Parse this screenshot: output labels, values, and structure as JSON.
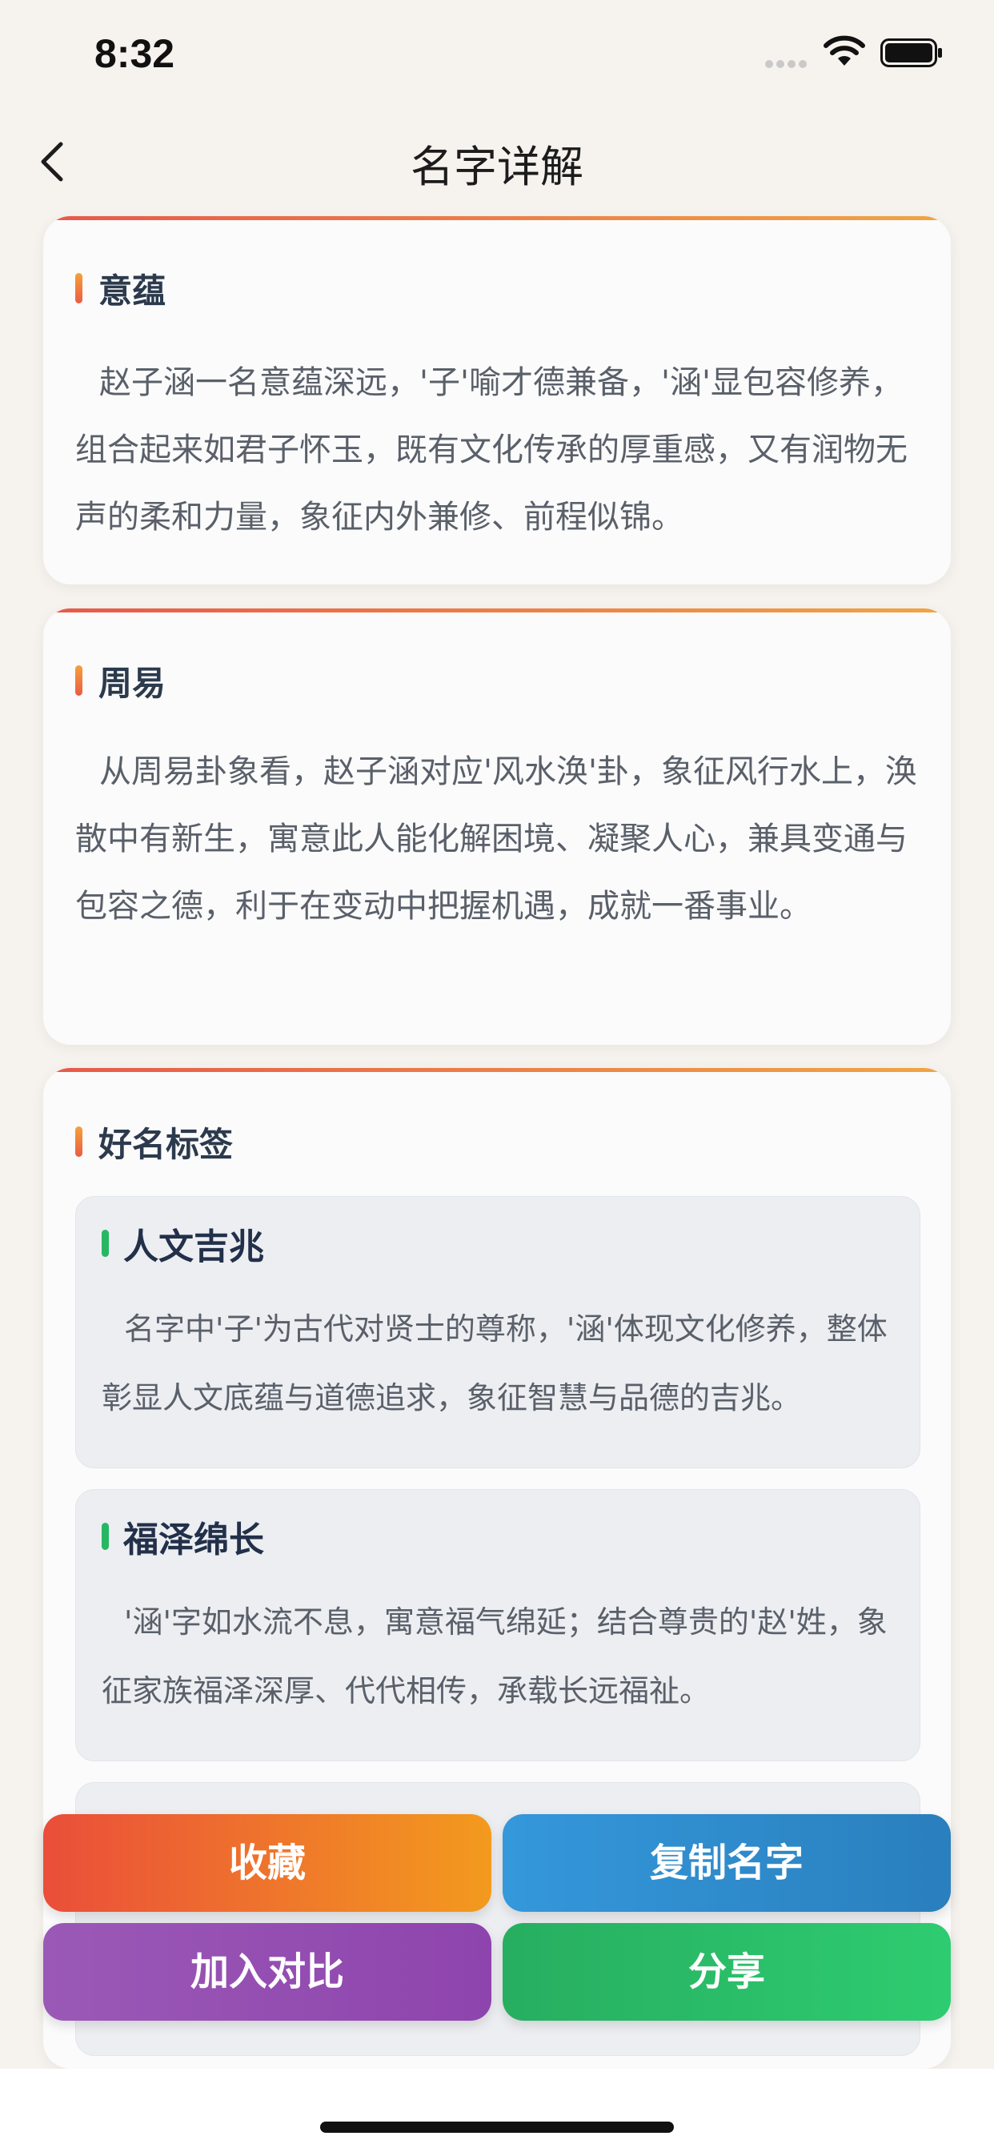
{
  "status": {
    "time": "8:32"
  },
  "nav": {
    "title": "名字详解"
  },
  "cards": {
    "meaning": {
      "title": "意蕴",
      "text": "赵子涵一名意蕴深远，'子'喻才德兼备，'涵'显包容修养，组合起来如君子怀玉，既有文化传承的厚重感，又有润物无声的柔和力量，象征内外兼修、前程似锦。"
    },
    "zhouyi": {
      "title": "周易",
      "text": "从周易卦象看，赵子涵对应'风水涣'卦，象征风行水上，涣散中有新生，寓意此人能化解困境、凝聚人心，兼具变通与包容之德，利于在变动中把握机遇，成就一番事业。"
    },
    "tags": {
      "title": "好名标签",
      "items": [
        {
          "title": "人文吉兆",
          "text": "名字中'子'为古代对贤士的尊称，'涵'体现文化修养，整体彰显人文底蕴与道德追求，象征智慧与品德的吉兆。"
        },
        {
          "title": "福泽绵长",
          "text": "'涵'字如水流不息，寓意福气绵延；结合尊贵的'赵'姓，象征家族福泽深厚、代代相传，承载长远福祉。"
        }
      ]
    }
  },
  "actions": {
    "favorite": "收藏",
    "copy_name": "复制名字",
    "compare": "加入对比",
    "share": "分享"
  },
  "colors": {
    "accent_orange": "#f39a1e",
    "accent_red": "#ea4e3a",
    "blue": "#3498db",
    "purple": "#9b59b6",
    "green": "#27ae60"
  }
}
